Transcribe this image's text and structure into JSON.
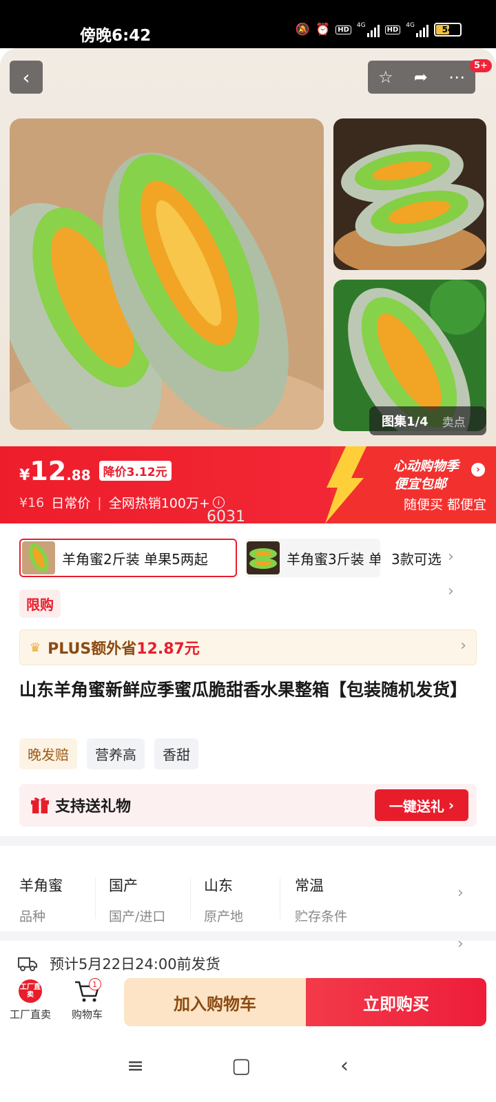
{
  "status_bar": {
    "time": "傍晚6:42",
    "battery": "54",
    "net1": "4G",
    "net2": "4G",
    "hd": "HD"
  },
  "header": {
    "notification_badge": "5+"
  },
  "gallery": {
    "label": "图集1/4",
    "alt_label": "卖点"
  },
  "price": {
    "currency": "¥",
    "integer": "12",
    "decimal": ".88",
    "drop_tag": "降价3.12元",
    "regular_price": "¥16",
    "regular_label": "日常价",
    "hot_sales": "全网热销100万+",
    "promo_line1": "心动购物季",
    "promo_line2": "便宜包邮",
    "promo_line3": "随便买 都便宜",
    "watermark": "6031"
  },
  "variants": {
    "items": [
      {
        "label": "羊角蜜2斤装 单果5两起",
        "selected": true
      },
      {
        "label": "羊角蜜3斤装 单",
        "selected": false
      }
    ],
    "count_label": "3款可选"
  },
  "limit_label": "限购",
  "plus": {
    "text": "PLUS额外省",
    "amount": "12.87元"
  },
  "product": {
    "title": "山东羊角蜜新鲜应季蜜瓜脆甜香水果整箱【包装随机发货】",
    "tags": [
      "晚发赔",
      "营养高",
      "香甜"
    ]
  },
  "gift": {
    "text": "支持送礼物",
    "button": "一键送礼"
  },
  "attributes": [
    {
      "value": "羊角蜜",
      "key": "品种"
    },
    {
      "value": "国产",
      "key": "国产/进口"
    },
    {
      "value": "山东",
      "key": "原产地"
    },
    {
      "value": "常温",
      "key": "贮存条件"
    }
  ],
  "shipping": {
    "text": "预计5月22日24:00前发货"
  },
  "bottom_bar": {
    "factory_icon_text": "工厂直卖",
    "factory_label": "工厂直卖",
    "cart_label": "购物车",
    "cart_count": "1",
    "add_to_cart": "加入购物车",
    "buy_now": "立即购买"
  },
  "colors": {
    "accent": "#e81d2c",
    "gold": "#8a4b12",
    "melon_green": "#7fcf3c",
    "melon_orange": "#f0a020"
  }
}
